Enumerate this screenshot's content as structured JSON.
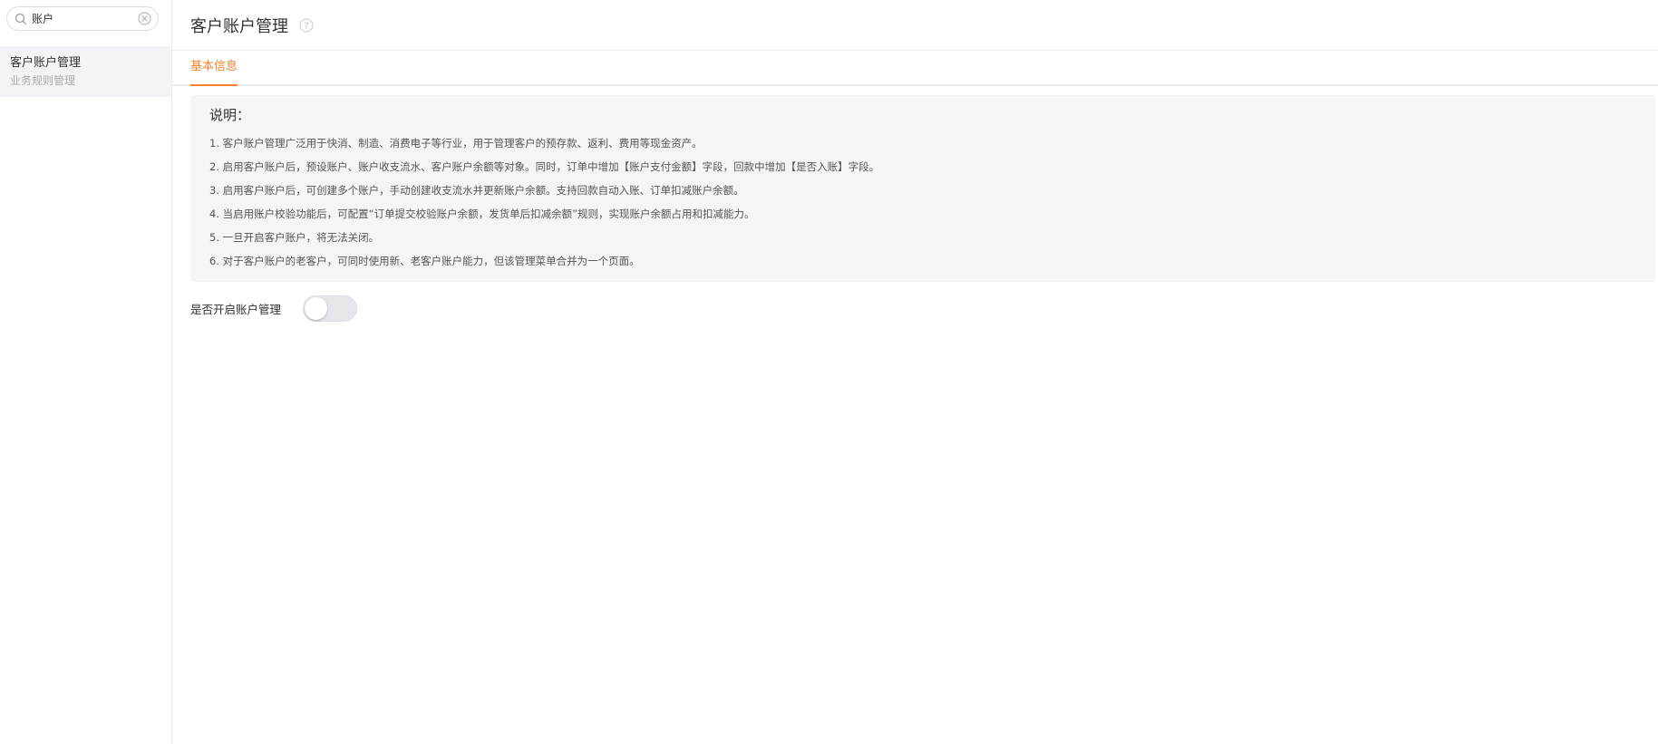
{
  "sidebar": {
    "search": {
      "value": "账户",
      "placeholder": ""
    },
    "items": [
      {
        "label": "客户账户管理",
        "sublabel": "业务规则管理"
      }
    ]
  },
  "header": {
    "title": "客户账户管理"
  },
  "tabs": [
    {
      "label": "基本信息",
      "active": true
    }
  ],
  "note": {
    "title": "说明：",
    "lines": [
      "1. 客户账户管理广泛用于快消、制造、消费电子等行业，用于管理客户的预存款、返利、费用等现金资产。",
      "2. 启用客户账户后，预设账户、账户收支流水、客户账户余额等对象。同时，订单中增加【账户支付金额】字段，回款中增加【是否入账】字段。",
      "3. 启用客户账户后，可创建多个账户，手动创建收支流水并更新账户余额。支持回款自动入账、订单扣减账户余额。",
      "4. 当启用账户校验功能后，可配置“订单提交校验账户余额，发货单后扣减余额”规则，实现账户余额占用和扣减能力。",
      "5. 一旦开启客户账户，将无法关闭。",
      "6. 对于客户账户的老客户，可同时使用新、老客户账户能力，但该管理菜单合并为一个页面。"
    ]
  },
  "toggle": {
    "label": "是否开启账户管理",
    "on": false
  },
  "colors": {
    "accent": "#f7822a",
    "note_bg": "#f4f5f8"
  }
}
